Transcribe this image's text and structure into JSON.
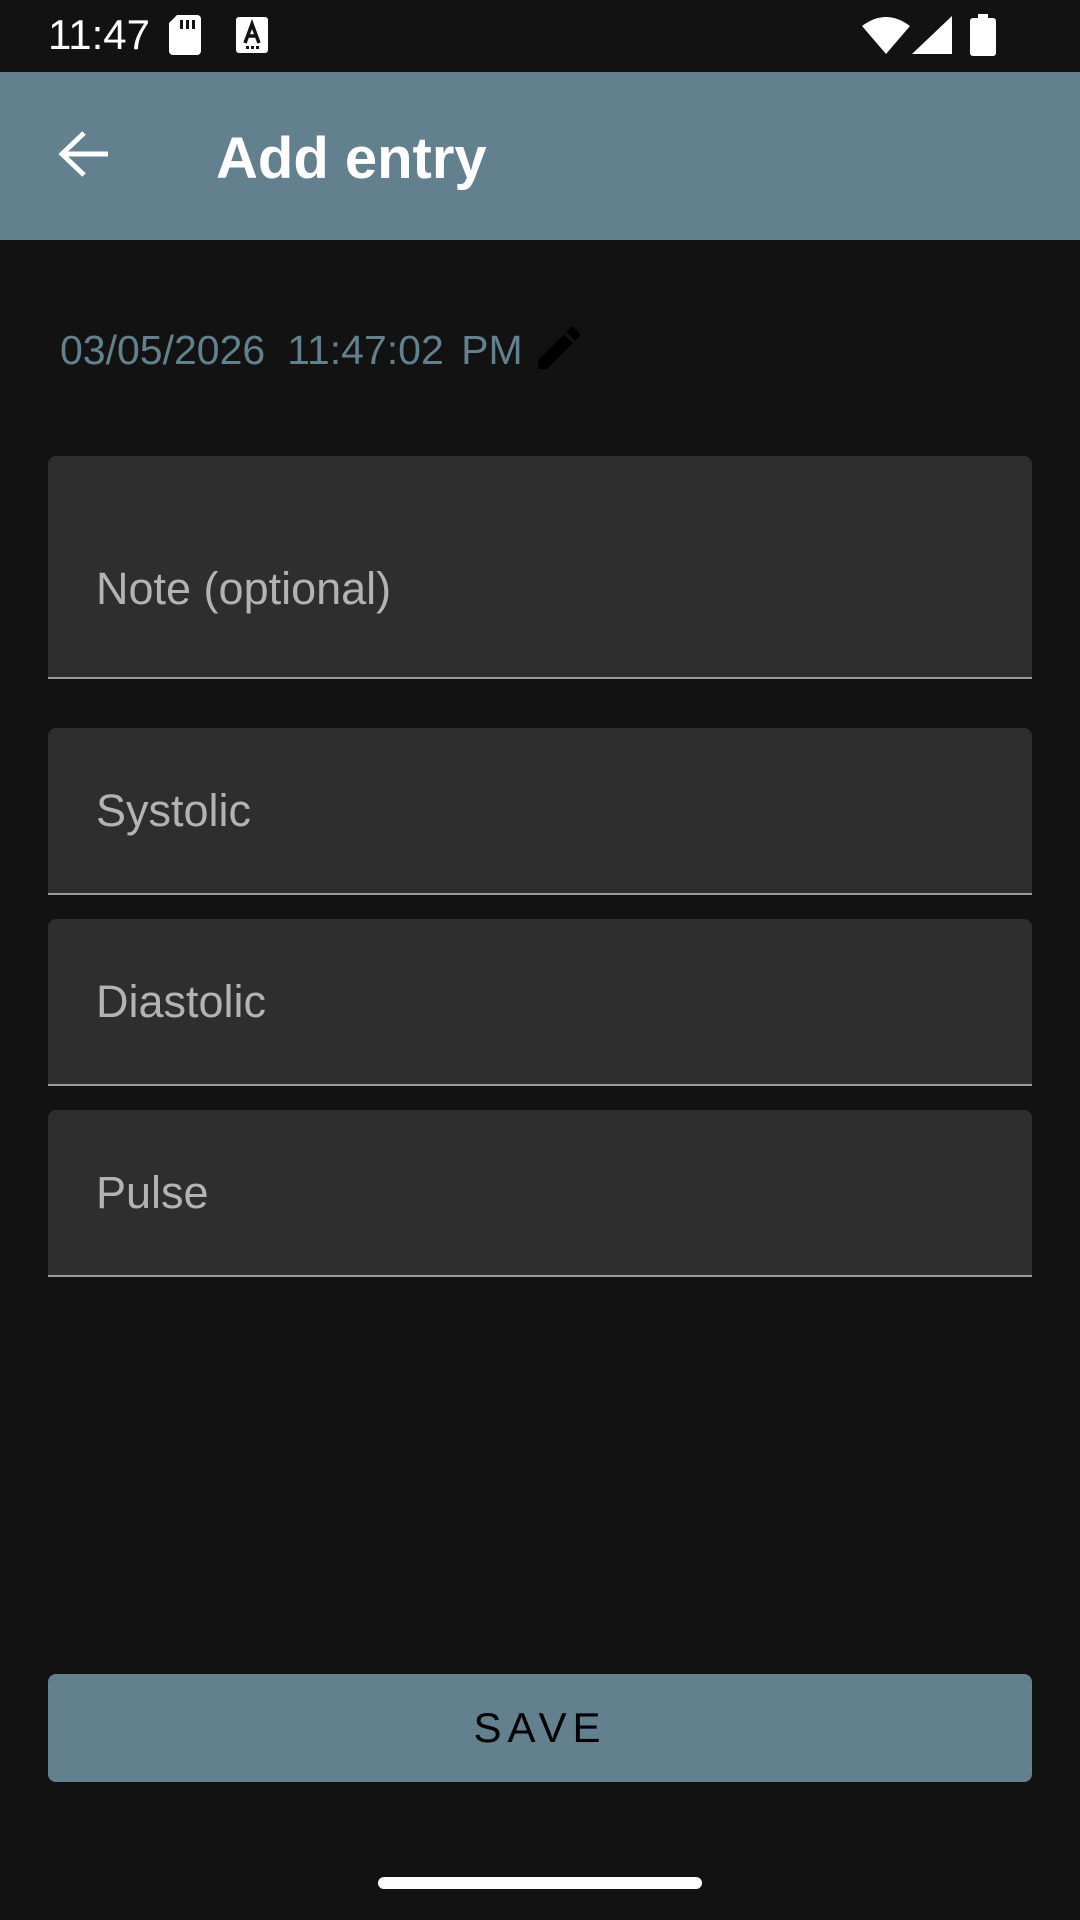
{
  "status_bar": {
    "time": "11:47",
    "icons": [
      "sd-card-icon",
      "text-a-icon",
      "wifi-icon",
      "cell-signal-icon",
      "battery-icon"
    ]
  },
  "app_bar": {
    "title": "Add entry",
    "back_icon": "arrow-back-icon",
    "background_color": "#62808d"
  },
  "datetime": {
    "date": "03/05/2026",
    "time": "11:47:02 PM",
    "edit_icon": "pencil-edit-icon",
    "color": "#62808d"
  },
  "form": {
    "fields": [
      {
        "label": "Note (optional)",
        "value": ""
      },
      {
        "label": "Systolic",
        "value": ""
      },
      {
        "label": "Diastolic",
        "value": ""
      },
      {
        "label": "Pulse",
        "value": ""
      }
    ]
  },
  "save_button": {
    "label": "SAVE",
    "color": "#62808d"
  },
  "theme": {
    "background": "#121212",
    "field_background": "#2e2e2e",
    "field_underline": "#9b9b9b"
  }
}
